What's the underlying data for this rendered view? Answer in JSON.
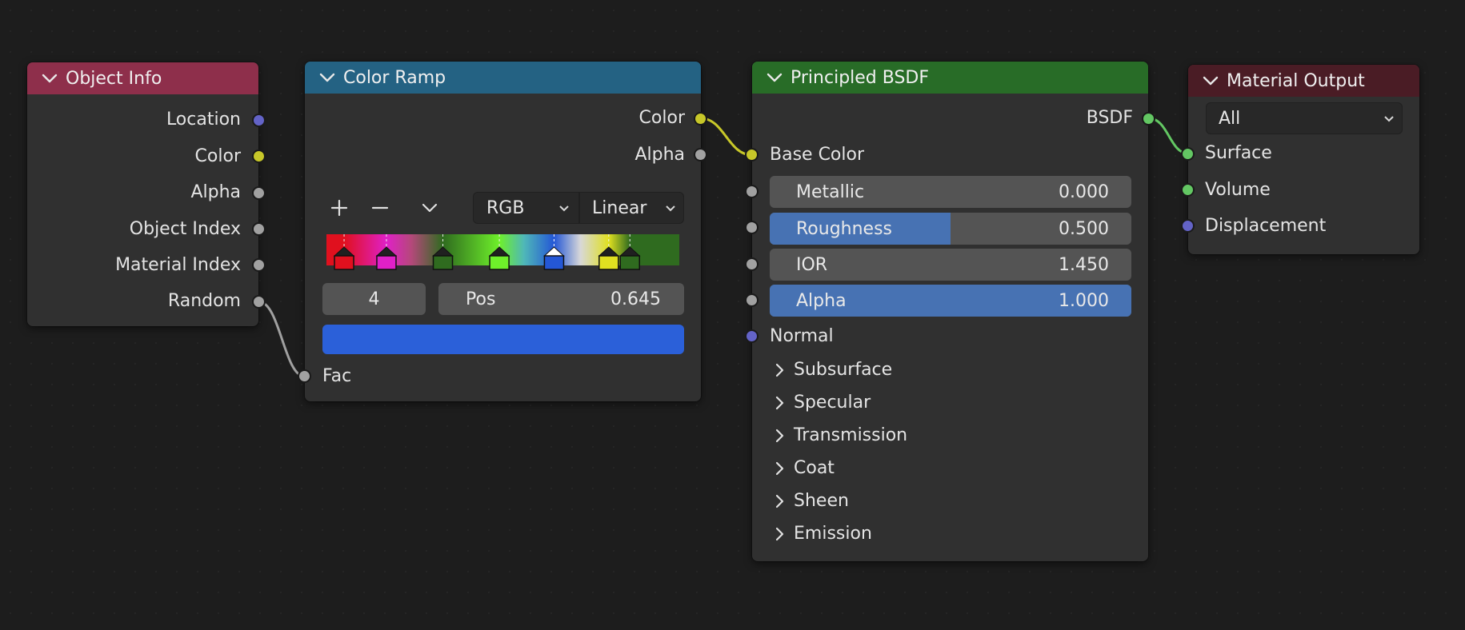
{
  "nodes": {
    "object_info": {
      "title": "Object Info",
      "header_color": "#8e2f4b",
      "outputs": [
        {
          "label": "Location",
          "socket": "vector"
        },
        {
          "label": "Color",
          "socket": "color"
        },
        {
          "label": "Alpha",
          "socket": "float"
        },
        {
          "label": "Object Index",
          "socket": "float"
        },
        {
          "label": "Material Index",
          "socket": "float"
        },
        {
          "label": "Random",
          "socket": "float"
        }
      ]
    },
    "color_ramp": {
      "title": "Color Ramp",
      "header_color": "#246283",
      "outputs": [
        {
          "label": "Color",
          "socket": "color"
        },
        {
          "label": "Alpha",
          "socket": "float"
        }
      ],
      "toolbar": {
        "add_icon": "plus-icon",
        "remove_icon": "minus-icon",
        "menu_icon": "chevron-down-icon",
        "color_mode": "RGB",
        "interpolation": "Linear"
      },
      "stops": [
        {
          "position": 0.05,
          "color": "#e0101e"
        },
        {
          "position": 0.17,
          "color": "#e020c8"
        },
        {
          "position": 0.33,
          "color": "#2f6b1f"
        },
        {
          "position": 0.49,
          "color": "#6ef02a"
        },
        {
          "position": 0.645,
          "color": "#2457d6",
          "active": true
        },
        {
          "position": 0.8,
          "color": "#e0e020"
        },
        {
          "position": 0.86,
          "color": "#2f6b1f"
        }
      ],
      "active_index": "4",
      "pos_label": "Pos",
      "pos_value": "0.645",
      "active_color": "#2b60d9",
      "inputs": [
        {
          "label": "Fac",
          "socket": "float"
        }
      ]
    },
    "principled_bsdf": {
      "title": "Principled BSDF",
      "header_color": "#286c27",
      "output": {
        "label": "BSDF",
        "socket": "shader"
      },
      "base_color_label": "Base Color",
      "fields": [
        {
          "label": "Metallic",
          "value": "0.000",
          "fraction": 0.0
        },
        {
          "label": "Roughness",
          "value": "0.500",
          "fraction": 0.5
        },
        {
          "label": "IOR",
          "value": "1.450",
          "fraction": 0.0
        },
        {
          "label": "Alpha",
          "value": "1.000",
          "fraction": 1.0
        }
      ],
      "normal_label": "Normal",
      "panels": [
        "Subsurface",
        "Specular",
        "Transmission",
        "Coat",
        "Sheen",
        "Emission"
      ]
    },
    "material_output": {
      "title": "Material Output",
      "header_color": "#4a1c25",
      "target": "All",
      "inputs": [
        {
          "label": "Surface",
          "socket": "shader"
        },
        {
          "label": "Volume",
          "socket": "shader"
        },
        {
          "label": "Displacement",
          "socket": "vector"
        }
      ]
    }
  },
  "links": [
    {
      "from": "Object Info.Random",
      "to": "Color Ramp.Fac",
      "color": "#a0a0a0"
    },
    {
      "from": "Color Ramp.Color",
      "to": "Principled BSDF.Base Color",
      "color": "#c7c729"
    },
    {
      "from": "Principled BSDF.BSDF",
      "to": "Material Output.Surface",
      "color": "#63c763"
    }
  ]
}
